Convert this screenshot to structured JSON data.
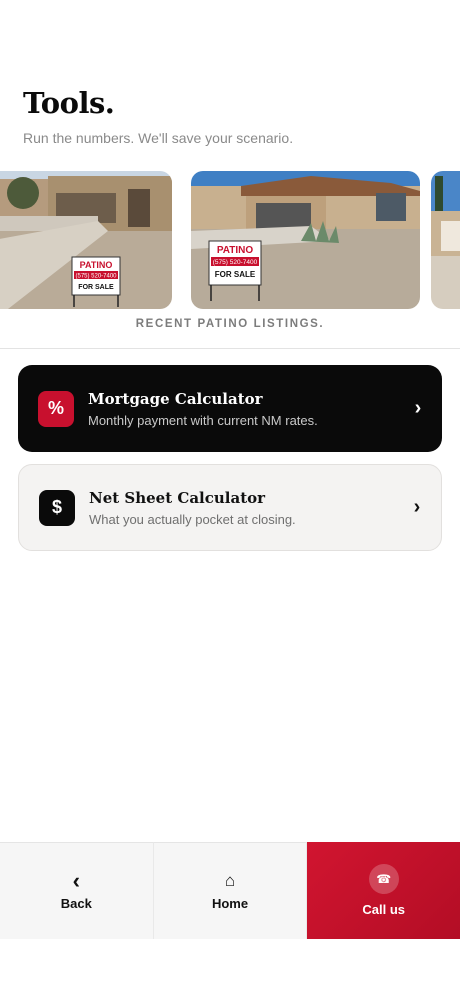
{
  "header": {
    "title": "Tools.",
    "subtitle": "Run the numbers. We'll save your scenario."
  },
  "listings": {
    "caption": "RECENT PATINO LISTINGS.",
    "photos": [
      {
        "sign_brand": "PATINO",
        "sign_phone": "(575) 520-7400",
        "sign_text": "FOR SALE"
      },
      {
        "sign_brand": "PATINO",
        "sign_phone": "(575) 520-7400",
        "sign_text": "FOR SALE"
      },
      {}
    ]
  },
  "tools": [
    {
      "icon": "%",
      "icon_name": "percent-icon",
      "title": "Mortgage Calculator",
      "description": "Monthly payment with current NM rates.",
      "chevron": "›"
    },
    {
      "icon": "$",
      "icon_name": "dollar-icon",
      "title": "Net Sheet Calculator",
      "description": "What you actually pocket at closing.",
      "chevron": "›"
    }
  ],
  "bottom_nav": {
    "back": {
      "icon": "‹",
      "label": "Back"
    },
    "home": {
      "icon": "⌂",
      "label": "Home"
    },
    "call": {
      "icon": "☎",
      "label": "Call us"
    }
  },
  "colors": {
    "brand_red": "#c8102e",
    "dark_card": "#0a0a0a",
    "light_card": "#f4f3f2"
  }
}
